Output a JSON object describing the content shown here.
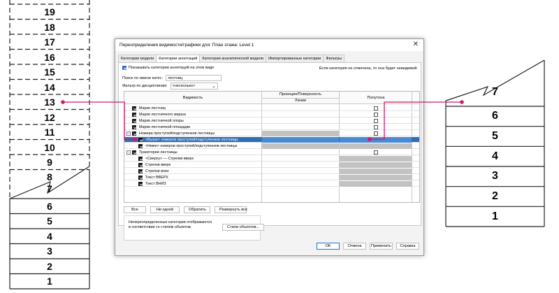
{
  "left_stair": {
    "upper_steps": [
      "19",
      "18",
      "17",
      "16",
      "15",
      "14",
      "13",
      "12",
      "11",
      "10",
      "9",
      "8",
      "7"
    ],
    "lower_steps": [
      "6",
      "5",
      "4",
      "3",
      "2",
      "1"
    ]
  },
  "right_stair": {
    "steps": [
      "7",
      "6",
      "5",
      "4",
      "3",
      "2",
      "1"
    ]
  },
  "callout_color": "#d6176b",
  "dialog": {
    "title": "Переопределения видимости/графики для: План этажа: Level 1",
    "close_glyph": "✕",
    "tabs": [
      {
        "label": "Категории модели"
      },
      {
        "label": "Категории аннотаций"
      },
      {
        "label": "Категории аналитической модели"
      },
      {
        "label": "Импортированные категории"
      },
      {
        "label": "Фильтры"
      }
    ],
    "show_annotations_label": "Показывать категории аннотаций на этом виде",
    "hint": "Если категория не отмечена, то она будет невидимой.",
    "search_label": "Поиск по имени катег.:",
    "search_value": "лестниц",
    "filter_label": "Фильтр по дисциплинам:",
    "filter_value": "<несколько>",
    "grid": {
      "col_visibility": "Видимость",
      "col_projection": "Проекция/Поверхность",
      "col_lines": "Линии",
      "col_halftone": "Полутона",
      "rows": [
        {
          "name": "Марки лестниц"
        },
        {
          "name": "Марки лестничного марша"
        },
        {
          "name": "Марки лестничной опоры"
        },
        {
          "name": "Марки лестничной площадки"
        },
        {
          "name": "Номера проступей/подступенков лестницы"
        },
        {
          "name": "<Выше> номеров проступей/подступенков лестницы"
        },
        {
          "name": "<Ниже> номеров проступей/подступенков лестницы"
        },
        {
          "name": "Траектории лестницы"
        },
        {
          "name": "<Сверху> — Стрелки вверх"
        },
        {
          "name": "Стрелки вверх"
        },
        {
          "name": "Стрелки вниз"
        },
        {
          "name": "Текст ВВЕРХ"
        },
        {
          "name": "Текст ВНИЗ"
        }
      ]
    },
    "buttons": {
      "all": "Все",
      "none": "Ни одной",
      "invert": "Обратить",
      "expand_all": "Развернуть все"
    },
    "object_styles": {
      "text": "Непереопределенные категории отображаются в соответствии со стилем объектов.",
      "button": "Стили объектов..."
    },
    "footer": {
      "ok": "OK",
      "cancel": "Отмена",
      "apply": "Применить",
      "help": "Справка"
    }
  }
}
